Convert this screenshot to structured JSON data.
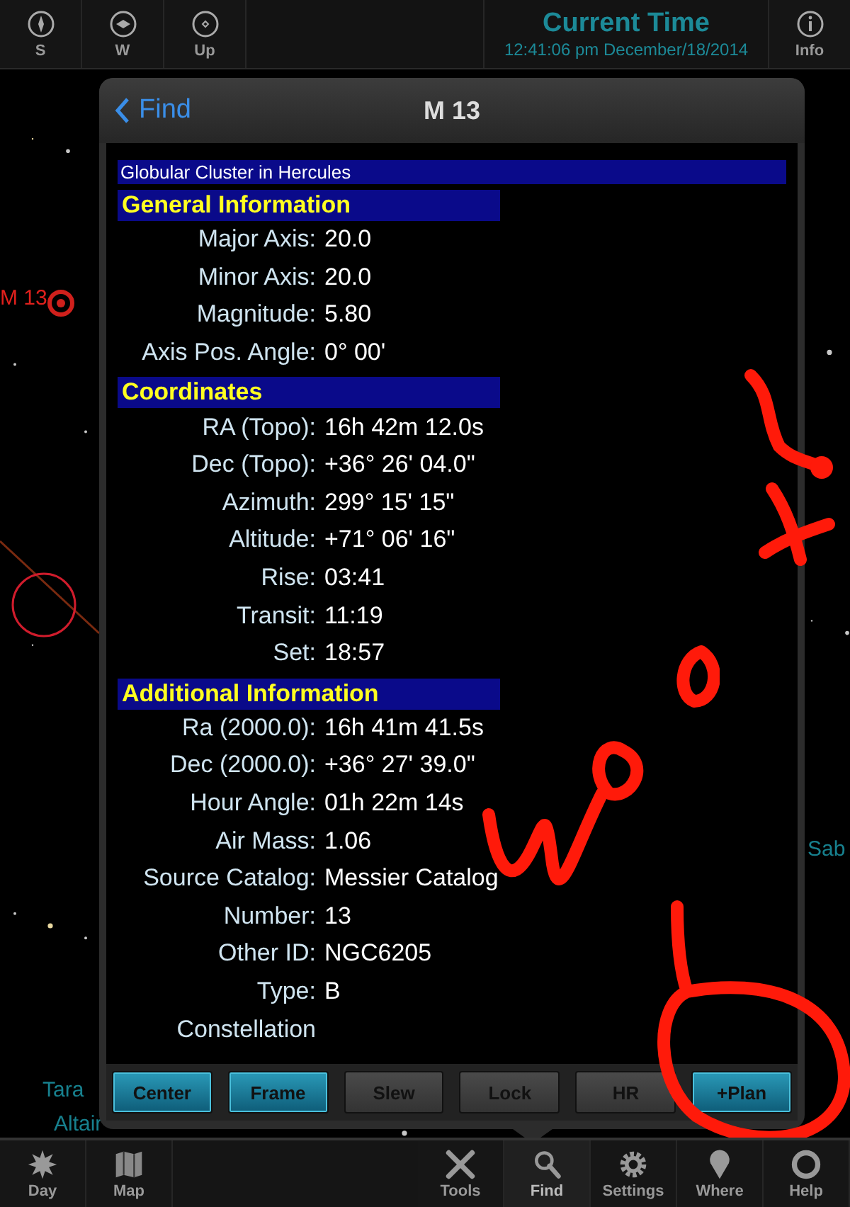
{
  "top_bar": {
    "left_buttons": [
      {
        "label": "S"
      },
      {
        "label": "W"
      },
      {
        "label": "Up"
      }
    ],
    "clock": {
      "title": "Current Time",
      "time": "12:41:06 pm December/18/2014"
    },
    "info_button": {
      "label": "Info"
    }
  },
  "sky_labels": [
    {
      "text": "M 13",
      "color": "#e0201c"
    },
    {
      "text": "Tara",
      "color": "#17808e"
    },
    {
      "text": "Altair",
      "color": "#17808e"
    },
    {
      "text": "Sab",
      "color": "#17808e"
    }
  ],
  "panel": {
    "back": "Find",
    "title": "M 13",
    "subtitle": "Globular Cluster in Hercules",
    "sections": [
      {
        "title": "General Information",
        "rows": [
          {
            "label": "Major Axis:",
            "value": "20.0"
          },
          {
            "label": "Minor Axis:",
            "value": "20.0"
          },
          {
            "label": "Magnitude:",
            "value": "5.80"
          },
          {
            "label": "Axis Pos. Angle:",
            "value": "0° 00'"
          }
        ]
      },
      {
        "title": "Coordinates",
        "rows": [
          {
            "label": "RA (Topo):",
            "value": "16h 42m 12.0s"
          },
          {
            "label": "Dec (Topo):",
            "value": "+36° 26' 04.0\""
          },
          {
            "label": "Azimuth:",
            "value": "299° 15' 15\""
          },
          {
            "label": "Altitude:",
            "value": "+71° 06' 16\""
          },
          {
            "label": "Rise:",
            "value": "03:41"
          },
          {
            "label": "Transit:",
            "value": "11:19"
          },
          {
            "label": "Set:",
            "value": "18:57"
          }
        ]
      },
      {
        "title": "Additional Information",
        "rows": [
          {
            "label": "Ra (2000.0):",
            "value": "16h 41m 41.5s"
          },
          {
            "label": "Dec (2000.0):",
            "value": "+36° 27' 39.0\""
          },
          {
            "label": "Hour Angle:",
            "value": "01h 22m 14s"
          },
          {
            "label": "Air Mass:",
            "value": "1.06"
          },
          {
            "label": "Source Catalog:",
            "value": "Messier Catalog"
          },
          {
            "label": "Number:",
            "value": "13"
          },
          {
            "label": "Other ID:",
            "value": "NGC6205"
          },
          {
            "label": "Type:",
            "value": "B"
          },
          {
            "label": "Constellation"
          }
        ]
      }
    ],
    "buttons": [
      {
        "label": "Center",
        "disabled": false
      },
      {
        "label": "Frame",
        "disabled": false
      },
      {
        "label": "Slew",
        "disabled": true
      },
      {
        "label": "Lock",
        "disabled": true
      },
      {
        "label": "HR",
        "disabled": true
      },
      {
        "label": "+Plan",
        "disabled": false
      }
    ]
  },
  "bottom_bar": {
    "left_items": [
      {
        "label": "Day",
        "selected": false
      },
      {
        "label": "Map",
        "selected": false
      }
    ],
    "right_items": [
      {
        "label": "Tools",
        "selected": false
      },
      {
        "label": "Find",
        "selected": true
      },
      {
        "label": "Settings",
        "selected": false
      },
      {
        "label": "Where",
        "selected": false
      },
      {
        "label": "Help",
        "selected": false
      }
    ]
  }
}
